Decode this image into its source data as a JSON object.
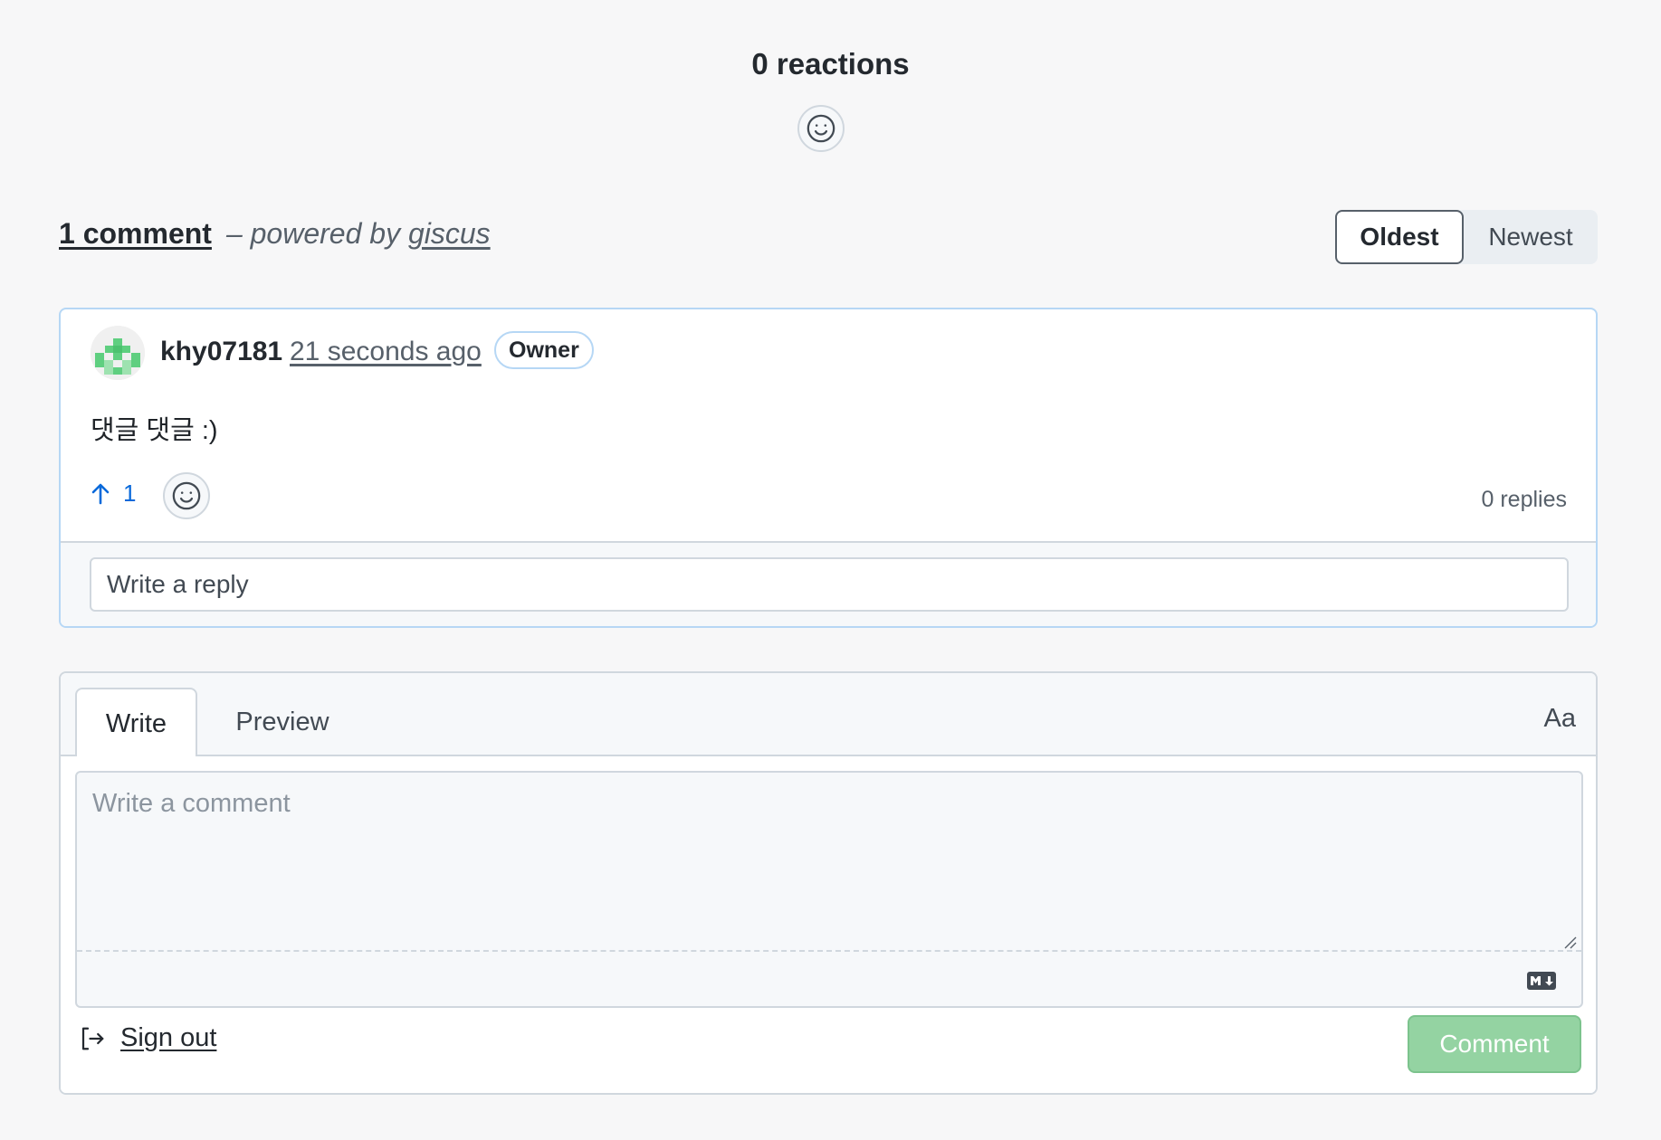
{
  "reactions": {
    "title": "0 reactions",
    "add_reaction_icon": "smiley-icon"
  },
  "comments_header": {
    "count_label": "1 comment",
    "powered_prefix": "– powered by ",
    "powered_link": "giscus"
  },
  "sort": {
    "options": [
      "Oldest",
      "Newest"
    ],
    "selected": "Oldest"
  },
  "comment": {
    "author": "khy07181",
    "time": "21 seconds ago",
    "badge": "Owner",
    "body": "댓글 댓글 :)",
    "upvote_count": "1",
    "replies": "0 replies",
    "reply_placeholder": "Write a reply"
  },
  "editor": {
    "tabs": [
      "Write",
      "Preview"
    ],
    "active_tab": "Write",
    "font_toggle": "Aa",
    "placeholder": "Write a comment",
    "sign_out": "Sign out",
    "submit": "Comment"
  },
  "colors": {
    "accent_blue": "#0969da",
    "submit_green": "#94d3a2",
    "card_border": "#b6d7f5"
  }
}
